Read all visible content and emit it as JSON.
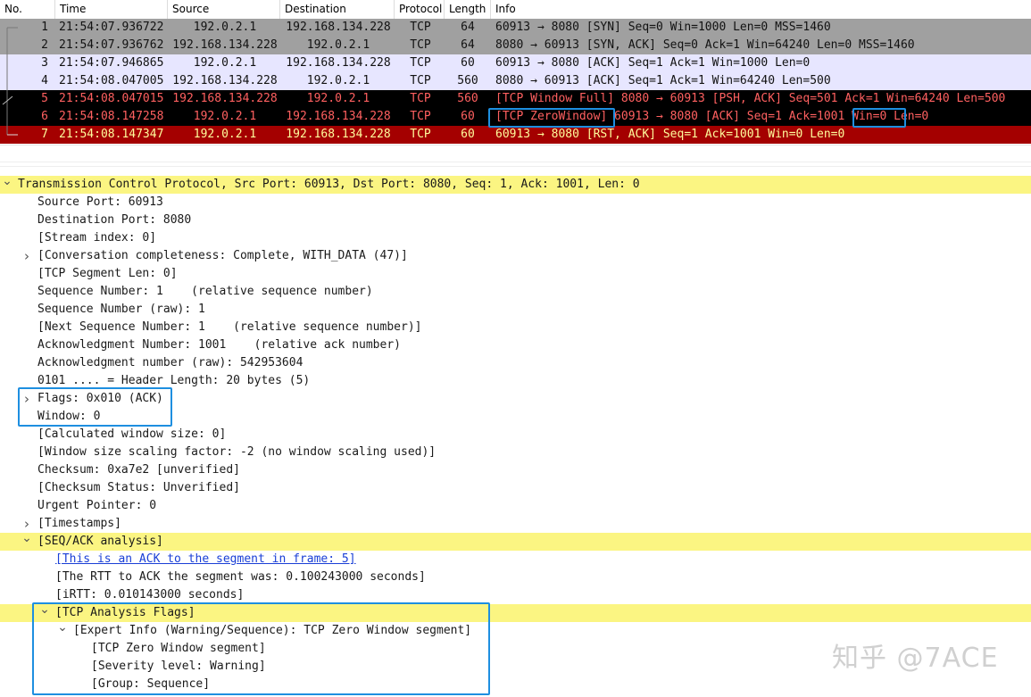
{
  "packet_list": {
    "columns": [
      "No.",
      "Time",
      "Source",
      "Destination",
      "Protocol",
      "Length",
      "Info"
    ],
    "rows": [
      {
        "no": "1",
        "time": "21:54:07.936722",
        "src": "192.0.2.1",
        "dst": "192.168.134.228",
        "proto": "TCP",
        "len": "64",
        "info": "60913 → 8080 [SYN] Seq=0 Win=1000 Len=0 MSS=1460",
        "bg": "#a0a0a0",
        "fg": "#121212"
      },
      {
        "no": "2",
        "time": "21:54:07.936762",
        "src": "192.168.134.228",
        "dst": "192.0.2.1",
        "proto": "TCP",
        "len": "64",
        "info": "8080 → 60913 [SYN, ACK] Seq=0 Ack=1 Win=64240 Len=0 MSS=1460",
        "bg": "#a0a0a0",
        "fg": "#121212"
      },
      {
        "no": "3",
        "time": "21:54:07.946865",
        "src": "192.0.2.1",
        "dst": "192.168.134.228",
        "proto": "TCP",
        "len": "60",
        "info": "60913 → 8080 [ACK] Seq=1 Ack=1 Win=1000 Len=0",
        "bg": "#e7e6ff",
        "fg": "#121212"
      },
      {
        "no": "4",
        "time": "21:54:08.047005",
        "src": "192.168.134.228",
        "dst": "192.0.2.1",
        "proto": "TCP",
        "len": "560",
        "info": "8080 → 60913 [ACK] Seq=1 Ack=1 Win=64240 Len=500",
        "bg": "#e7e6ff",
        "fg": "#121212"
      },
      {
        "no": "5",
        "time": "21:54:08.047015",
        "src": "192.168.134.228",
        "dst": "192.0.2.1",
        "proto": "TCP",
        "len": "560",
        "info": "[TCP Window Full] 8080 → 60913 [PSH, ACK] Seq=501 Ack=1 Win=64240 Len=500",
        "bg": "#000000",
        "fg": "#ff6060"
      },
      {
        "no": "6",
        "time": "21:54:08.147258",
        "src": "192.0.2.1",
        "dst": "192.168.134.228",
        "proto": "TCP",
        "len": "60",
        "info": "[TCP ZeroWindow] 60913 → 8080 [ACK] Seq=1 Ack=1001 Win=0 Len=0",
        "bg": "#000000",
        "fg": "#ff6060"
      },
      {
        "no": "7",
        "time": "21:54:08.147347",
        "src": "192.0.2.1",
        "dst": "192.168.134.228",
        "proto": "TCP",
        "len": "60",
        "info": "60913 → 8080 [RST, ACK] Seq=1 Ack=1001 Win=0 Len=0",
        "bg": "#a40000",
        "fg": "#fffc9c"
      }
    ]
  },
  "details": {
    "lines": [
      {
        "text": "Transmission Control Protocol, Src Port: 60913, Dst Port: 8080, Seq: 1, Ack: 1001, Len: 0",
        "indent": 0,
        "arrow": "down",
        "hl": true
      },
      {
        "text": "Source Port: 60913",
        "indent": 1
      },
      {
        "text": "Destination Port: 8080",
        "indent": 1
      },
      {
        "text": "[Stream index: 0]",
        "indent": 1
      },
      {
        "text": "[Conversation completeness: Complete, WITH_DATA (47)]",
        "indent": 1,
        "arrow": "right"
      },
      {
        "text": "[TCP Segment Len: 0]",
        "indent": 1
      },
      {
        "text": "Sequence Number: 1    (relative sequence number)",
        "indent": 1
      },
      {
        "text": "Sequence Number (raw): 1",
        "indent": 1
      },
      {
        "text": "[Next Sequence Number: 1    (relative sequence number)]",
        "indent": 1
      },
      {
        "text": "Acknowledgment Number: 1001    (relative ack number)",
        "indent": 1
      },
      {
        "text": "Acknowledgment number (raw): 542953604",
        "indent": 1
      },
      {
        "text": "0101 .... = Header Length: 20 bytes (5)",
        "indent": 1
      },
      {
        "text": "Flags: 0x010 (ACK)",
        "indent": 1,
        "arrow": "right"
      },
      {
        "text": "Window: 0",
        "indent": 1
      },
      {
        "text": "[Calculated window size: 0]",
        "indent": 1
      },
      {
        "text": "[Window size scaling factor: -2 (no window scaling used)]",
        "indent": 1
      },
      {
        "text": "Checksum: 0xa7e2 [unverified]",
        "indent": 1
      },
      {
        "text": "[Checksum Status: Unverified]",
        "indent": 1
      },
      {
        "text": "Urgent Pointer: 0",
        "indent": 1
      },
      {
        "text": "[Timestamps]",
        "indent": 1,
        "arrow": "right"
      },
      {
        "text": "[SEQ/ACK analysis]",
        "indent": 1,
        "arrow": "down",
        "hl": true
      },
      {
        "text": "[This is an ACK to the segment in frame: 5]",
        "indent": 2,
        "link": true
      },
      {
        "text": "[The RTT to ACK the segment was: 0.100243000 seconds]",
        "indent": 2
      },
      {
        "text": "[iRTT: 0.010143000 seconds]",
        "indent": 2
      },
      {
        "text": "[TCP Analysis Flags]",
        "indent": 2,
        "arrow": "down",
        "hl": true
      },
      {
        "text": "[Expert Info (Warning/Sequence): TCP Zero Window segment]",
        "indent": 3,
        "arrow": "down"
      },
      {
        "text": "[TCP Zero Window segment]",
        "indent": 4
      },
      {
        "text": "[Severity level: Warning]",
        "indent": 4
      },
      {
        "text": "[Group: Sequence]",
        "indent": 4
      }
    ]
  },
  "watermark": "知乎 @7ACE",
  "colors": {
    "highlight": "#fbf582",
    "annotation": "#1e8fe0",
    "link": "#1a3fd6"
  }
}
